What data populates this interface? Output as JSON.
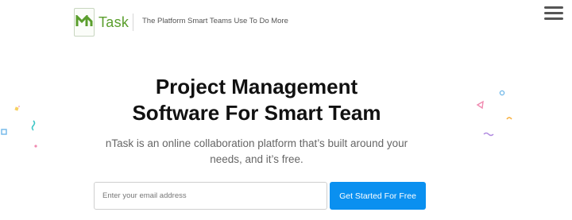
{
  "header": {
    "logo_text": "Task",
    "tagline": "The Platform Smart Teams Use To Do More",
    "menu_icon": "hamburger-menu-icon"
  },
  "hero": {
    "title_line1": "Project Management",
    "title_line2": "Software For Smart Team",
    "subtitle_line1": "nTask is an online collaboration platform that’s built around your",
    "subtitle_line2": "needs, and it’s free."
  },
  "signup": {
    "email_placeholder": "Enter your email address",
    "email_value": "",
    "cta_label": "Get Started For Free"
  },
  "colors": {
    "brand_green": "#5a9e2c",
    "cta_blue": "#0a90f0",
    "title": "#111111",
    "subtitle": "#666666"
  }
}
